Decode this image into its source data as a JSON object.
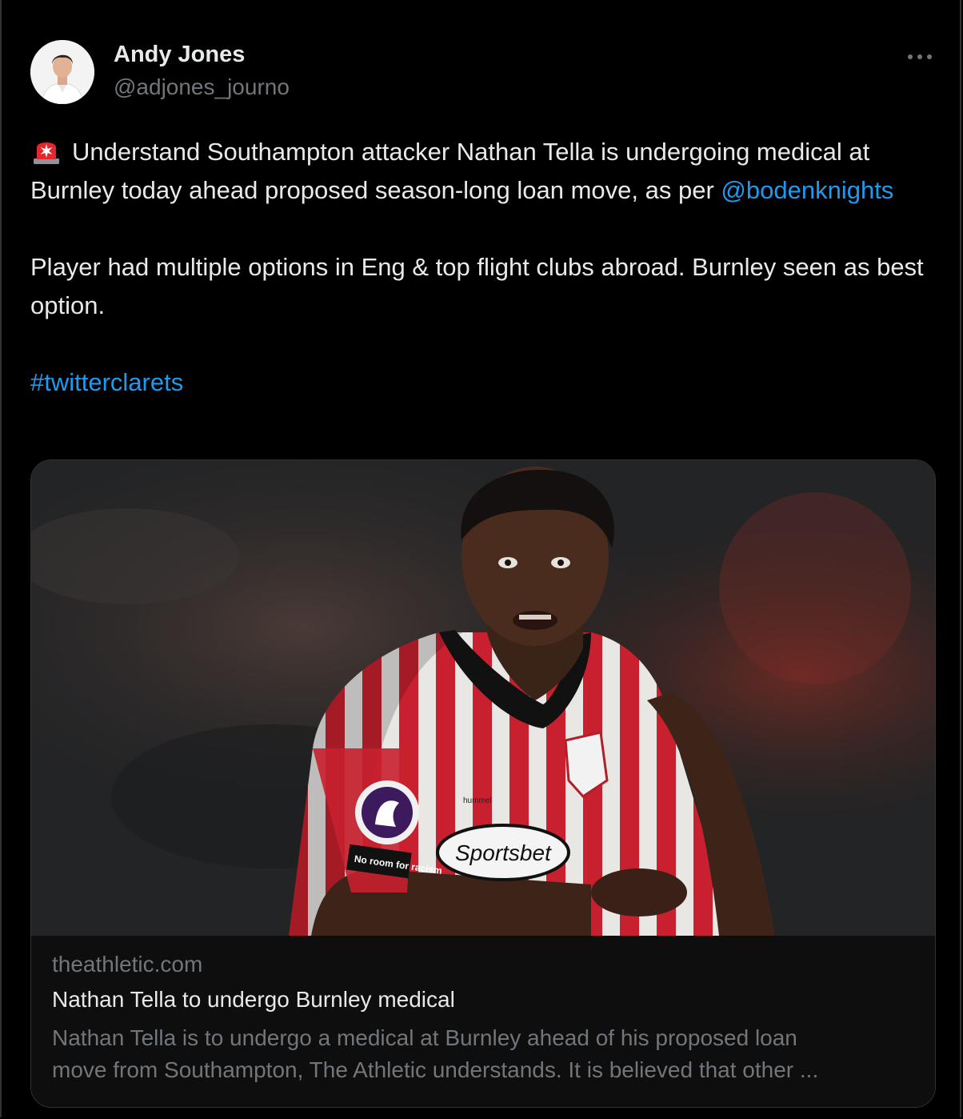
{
  "author": {
    "name": "Andy Jones",
    "handle": "@adjones_journo"
  },
  "tweet": {
    "icon": "siren-icon",
    "paragraph1": {
      "text": "Understand Southampton attacker Nathan Tella is undergoing medical at Burnley today ahead proposed season-long loan move, as per ",
      "mention": "@bodenknights"
    },
    "paragraph2": "Player had multiple options in Eng & top flight clubs abroad. Burnley seen as best option.",
    "hashtag": "#twitterclarets"
  },
  "link_card": {
    "image_badges": {
      "kit_brand": "hummel",
      "sponsor": "Sportsbet",
      "sleeve_patch": "No room for racism"
    },
    "domain": "theathletic.com",
    "title": "Nathan Tella to undergo Burnley medical",
    "description_line1": "Nathan Tella is to undergo a medical at Burnley ahead of his proposed loan",
    "description_line2": "move from Southampton, The Athletic understands.  It is believed that other ..."
  },
  "colors": {
    "background": "#000000",
    "text": "#e7e9ea",
    "muted": "#71767b",
    "link": "#1d9bf0",
    "border": "#2f3336"
  }
}
